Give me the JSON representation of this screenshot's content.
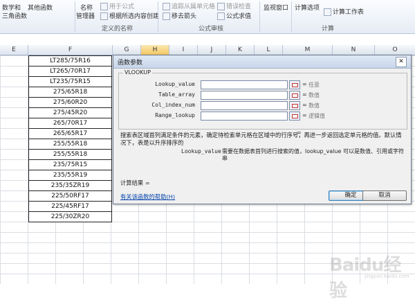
{
  "ribbon": {
    "top_items": [
      "数学和",
      "其他函数",
      "用于公式",
      "追踪从属单元格",
      "错误检查",
      "监视窗口",
      "计算选项",
      "计算工作表"
    ],
    "left_items": [
      "三角函数"
    ],
    "name_manager": [
      "名称",
      "管理器"
    ],
    "create_from_selection": "根据所选内容创建",
    "trace_dependents": "移去箭头",
    "evaluate_formula": "公式求值",
    "groups": {
      "defined_names": "定义的名称",
      "formula_auditing": "公式审核",
      "calculation": "计算"
    }
  },
  "columns": [
    "E",
    "F",
    "G",
    "H",
    "I",
    "J",
    "K",
    "L",
    "M",
    "N",
    "O"
  ],
  "cells": [
    "LT285/75R16",
    "LT265/70R17",
    "LT235/75R15",
    "275/65R18",
    "275/60R20",
    "275/45R20",
    "265/70R17",
    "265/65R17",
    "255/55R18",
    "255/55R18",
    "235/75R15",
    "235/55R19",
    "235/35ZR19",
    "225/50RF17",
    "225/45RF17",
    "225/30ZR20"
  ],
  "dialog": {
    "title": "函数参数",
    "close": "✕",
    "function_name": "VLOOKUP",
    "args": [
      {
        "name": "Lookup_value",
        "hint": "任意"
      },
      {
        "name": "Table_array",
        "hint": "数值"
      },
      {
        "name": "Col_index_num",
        "hint": "数值"
      },
      {
        "name": "Range_lookup",
        "hint": "逻辑值"
      }
    ],
    "eq": "=",
    "description": "搜索表区域首列满足条件的元素，确定待检索单元格在区域中的行序号，再进一步返回选定单元格的值。默认情况下，表是以升序排序的",
    "param_name": "Lookup_value",
    "param_desc": "需要在数据表首列进行搜索的值，lookup_value 可以是数值、引用或字符串",
    "result_label": "计算结果 =",
    "help_link": "有关该函数的帮助(H)",
    "ok": "确定",
    "cancel": "取消"
  },
  "watermark": {
    "logo": "Baidu经验",
    "url": "jingyan.baidu.com"
  }
}
